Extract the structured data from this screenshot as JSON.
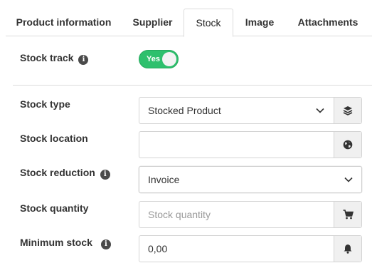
{
  "tabs": [
    {
      "label": "Product information"
    },
    {
      "label": "Supplier"
    },
    {
      "label": "Stock",
      "active": true
    },
    {
      "label": "Image"
    },
    {
      "label": "Attachments"
    }
  ],
  "stock_track": {
    "label": "Stock track",
    "toggle_label": "Yes",
    "enabled": true,
    "color": "#2ec06d"
  },
  "stock_type": {
    "label": "Stock type",
    "value": "Stocked Product",
    "addon_icon": "layers-icon"
  },
  "stock_location": {
    "label": "Stock location",
    "value": "",
    "addon_icon": "globe-icon"
  },
  "stock_reduction": {
    "label": "Stock reduction",
    "value": "Invoice"
  },
  "stock_quantity": {
    "label": "Stock quantity",
    "value": "",
    "placeholder": "Stock quantity",
    "addon_icon": "cart-icon"
  },
  "minimum_stock": {
    "label": "Minimum stock",
    "value": "0,00",
    "addon_icon": "bell-icon"
  }
}
